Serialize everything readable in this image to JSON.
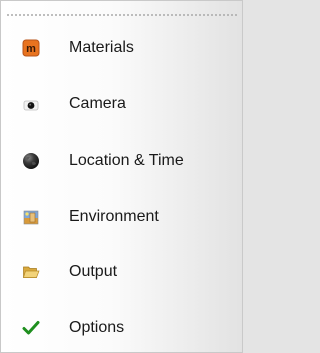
{
  "panel": {
    "items": [
      {
        "label": "Materials",
        "icon": "materials-icon",
        "accent": "#e8731f"
      },
      {
        "label": "Camera",
        "icon": "camera-icon",
        "accent": "#111111"
      },
      {
        "label": "Location & Time",
        "icon": "globe-icon",
        "accent": "#333333"
      },
      {
        "label": "Environment",
        "icon": "environment-icon",
        "accent": "#d89a3a"
      },
      {
        "label": "Output",
        "icon": "folder-open-icon",
        "accent": "#e9c25a"
      },
      {
        "label": "Options",
        "icon": "checkmark-icon",
        "accent": "#1f8f1f"
      }
    ]
  }
}
